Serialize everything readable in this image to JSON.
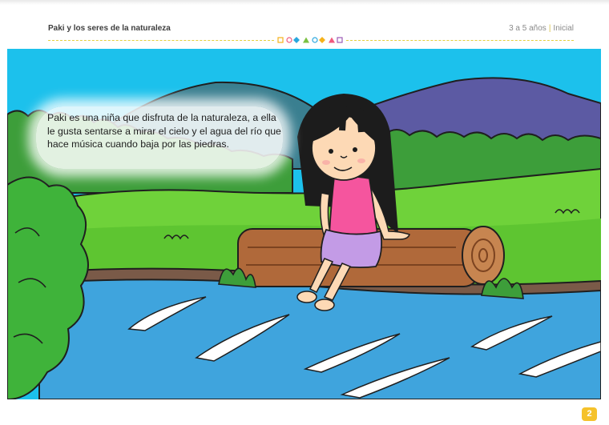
{
  "header": {
    "title": "Paki y los seres de la naturaleza",
    "age_range": "3 a 5 años",
    "level": "Inicial"
  },
  "story": {
    "text": "Paki es una niña que disfruta de la naturaleza, a ella le gusta sentarse a mirar el cielo y el agua del río que hace música cuando baja por las piedras."
  },
  "page_number": "2",
  "colors": {
    "accent_yellow": "#f5c22b",
    "sky": "#1cc1ec",
    "river": "#3fa4dd",
    "grass": "#6fd23a",
    "mountain": "#3a7f90",
    "shirt": "#f5559e"
  }
}
